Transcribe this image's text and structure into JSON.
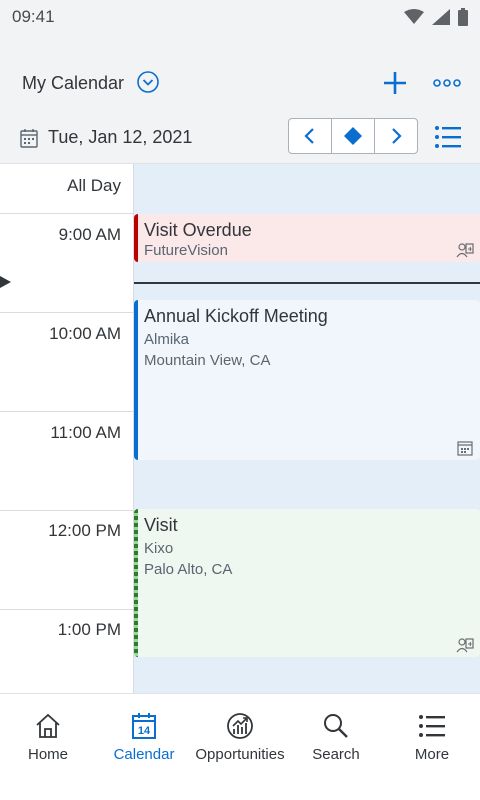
{
  "status": {
    "time": "09:41"
  },
  "header": {
    "title": "My Calendar"
  },
  "date": {
    "label": "Tue, Jan 12,  2021"
  },
  "allday": "All Day",
  "times": [
    "9:00 AM",
    "10:00 AM",
    "11:00 AM",
    "12:00 PM",
    "1:00 PM"
  ],
  "events": [
    {
      "title": "Visit Overdue",
      "account": "FutureVision",
      "location": "",
      "icon": "visit-icon",
      "color": "#bb0000"
    },
    {
      "title": "Annual Kickoff Meeting",
      "account": "Almika",
      "location": "Mountain View, CA",
      "icon": "calendar-icon",
      "color": "#0a6ed1"
    },
    {
      "title": "Visit",
      "account": "Kixo",
      "location": "Palo Alto, CA",
      "icon": "visit-icon",
      "color": "#2b7d2b"
    }
  ],
  "nav": [
    {
      "label": "Home",
      "icon": "home-icon"
    },
    {
      "label": "Calendar",
      "icon": "calendar-icon",
      "badge": "14",
      "active": true
    },
    {
      "label": "Opportunities",
      "icon": "opportunities-icon"
    },
    {
      "label": "Search",
      "icon": "search-icon"
    },
    {
      "label": "More",
      "icon": "list-icon"
    }
  ],
  "colors": {
    "accent": "#0a6ed1",
    "overdue": "#bb0000",
    "visit": "#2b7d2b"
  }
}
